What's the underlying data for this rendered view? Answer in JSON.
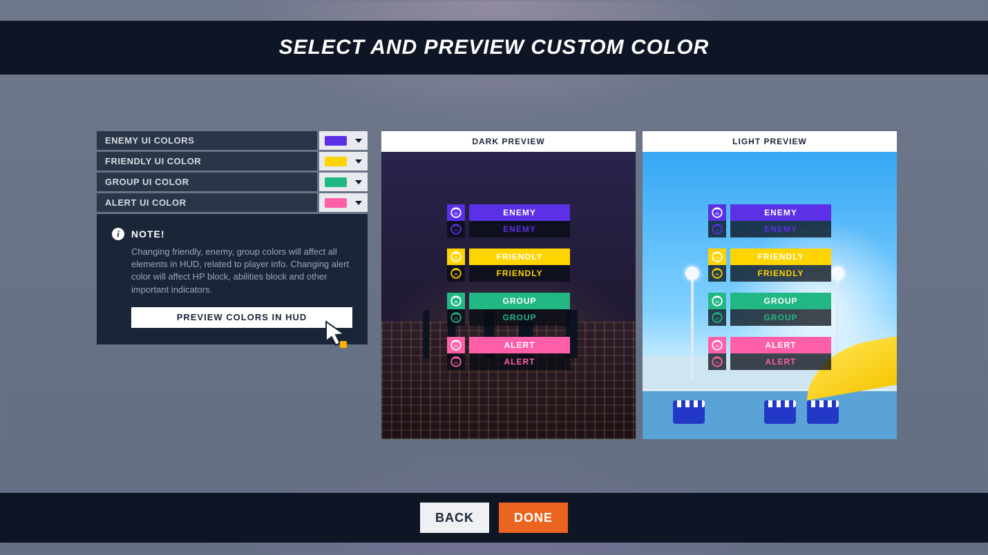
{
  "header": {
    "title": "SELECT AND PREVIEW CUSTOM COLOR"
  },
  "colors": {
    "enemy": "#5b30e6",
    "friendly": "#ffd400",
    "group": "#22b884",
    "alert": "#ff5fa8"
  },
  "settings": [
    {
      "key": "enemy",
      "label": "ENEMY UI COLORS"
    },
    {
      "key": "friendly",
      "label": "FRIENDLY UI COLOR"
    },
    {
      "key": "group",
      "label": "GROUP UI COLOR"
    },
    {
      "key": "alert",
      "label": "ALERT UI COLOR"
    }
  ],
  "note": {
    "title": "NOTE!",
    "body": "Changing friendly, enemy, group colors will affect all elements in HUD, related to player info. Changing alert color will affect HP block, abilities block and other important indicators.",
    "button": "PREVIEW COLORS IN HUD"
  },
  "previews": {
    "dark": "DARK PREVIEW",
    "light": "LIGHT PREVIEW"
  },
  "chip_labels": {
    "enemy": "ENEMY",
    "friendly": "FRIENDLY",
    "group": "GROUP",
    "alert": "ALERT"
  },
  "footer": {
    "back": "BACK",
    "done": "DONE"
  }
}
